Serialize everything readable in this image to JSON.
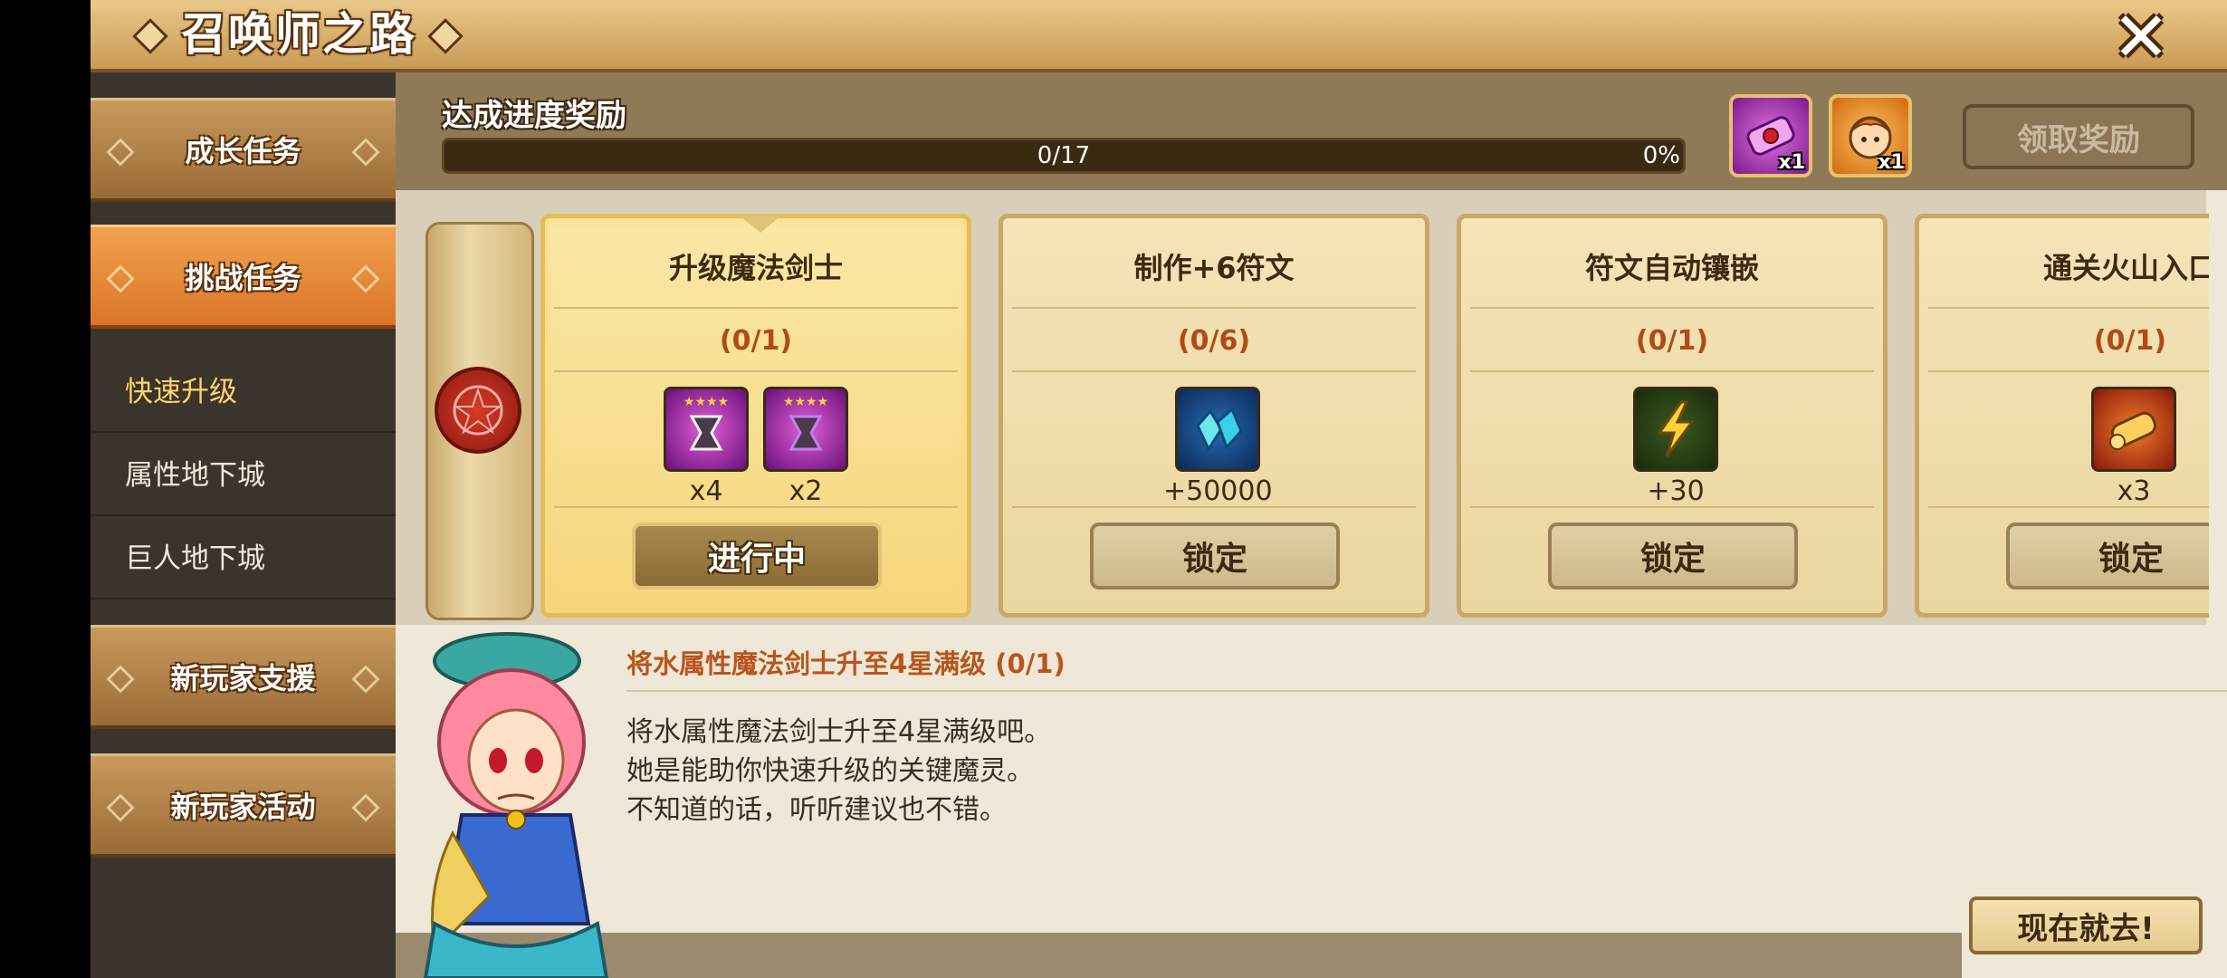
{
  "header": {
    "title": "召唤师之路",
    "close_icon": "close-x-icon"
  },
  "sidebar": {
    "tabs": [
      {
        "label": "成长任务",
        "state": "normal"
      },
      {
        "label": "挑战任务",
        "state": "active"
      }
    ],
    "subitems": [
      {
        "label": "快速升级",
        "selected": true
      },
      {
        "label": "属性地下城",
        "selected": false
      },
      {
        "label": "巨人地下城",
        "selected": false
      }
    ],
    "bottom_tabs": [
      {
        "label": "新玩家支援"
      },
      {
        "label": "新玩家活动"
      }
    ]
  },
  "progress": {
    "title": "达成进度奖励",
    "count": "0/17",
    "percent": "0%",
    "fraction": 0,
    "rewards": [
      {
        "icon": "summon-scroll-icon",
        "qty": "x1"
      },
      {
        "icon": "character-portrait-icon",
        "qty": "x1"
      }
    ],
    "claim_label": "领取奖励"
  },
  "cards": [
    {
      "title": "升级魔法剑士",
      "progress": "(0/1)",
      "items": [
        {
          "icon": "star4-devilmon-icon",
          "qty": "x4"
        },
        {
          "icon": "star4-devilmon-icon",
          "qty": "x2"
        }
      ],
      "button": "进行中",
      "state": "inprogress"
    },
    {
      "title": "制作+6符文",
      "progress": "(0/6)",
      "items": [
        {
          "icon": "crystal-icon",
          "qty": "+50000"
        }
      ],
      "button": "锁定",
      "state": "locked"
    },
    {
      "title": "符文自动镶嵌",
      "progress": "(0/1)",
      "items": [
        {
          "icon": "energy-icon",
          "qty": "+30"
        }
      ],
      "button": "锁定",
      "state": "locked"
    },
    {
      "title": "通关火山入口",
      "progress": "(0/1)",
      "items": [
        {
          "icon": "fire-scroll-icon",
          "qty": "x3"
        }
      ],
      "button": "锁定",
      "state": "locked"
    }
  ],
  "description": {
    "title": "将水属性魔法剑士升至4星满级 (0/1)",
    "lines": [
      "将水属性魔法剑士升至4星满级吧。",
      "她是能助你快速升级的关键魔灵。",
      "不知道的话，听听建议也不错。"
    ],
    "go_label": "现在就去!"
  }
}
